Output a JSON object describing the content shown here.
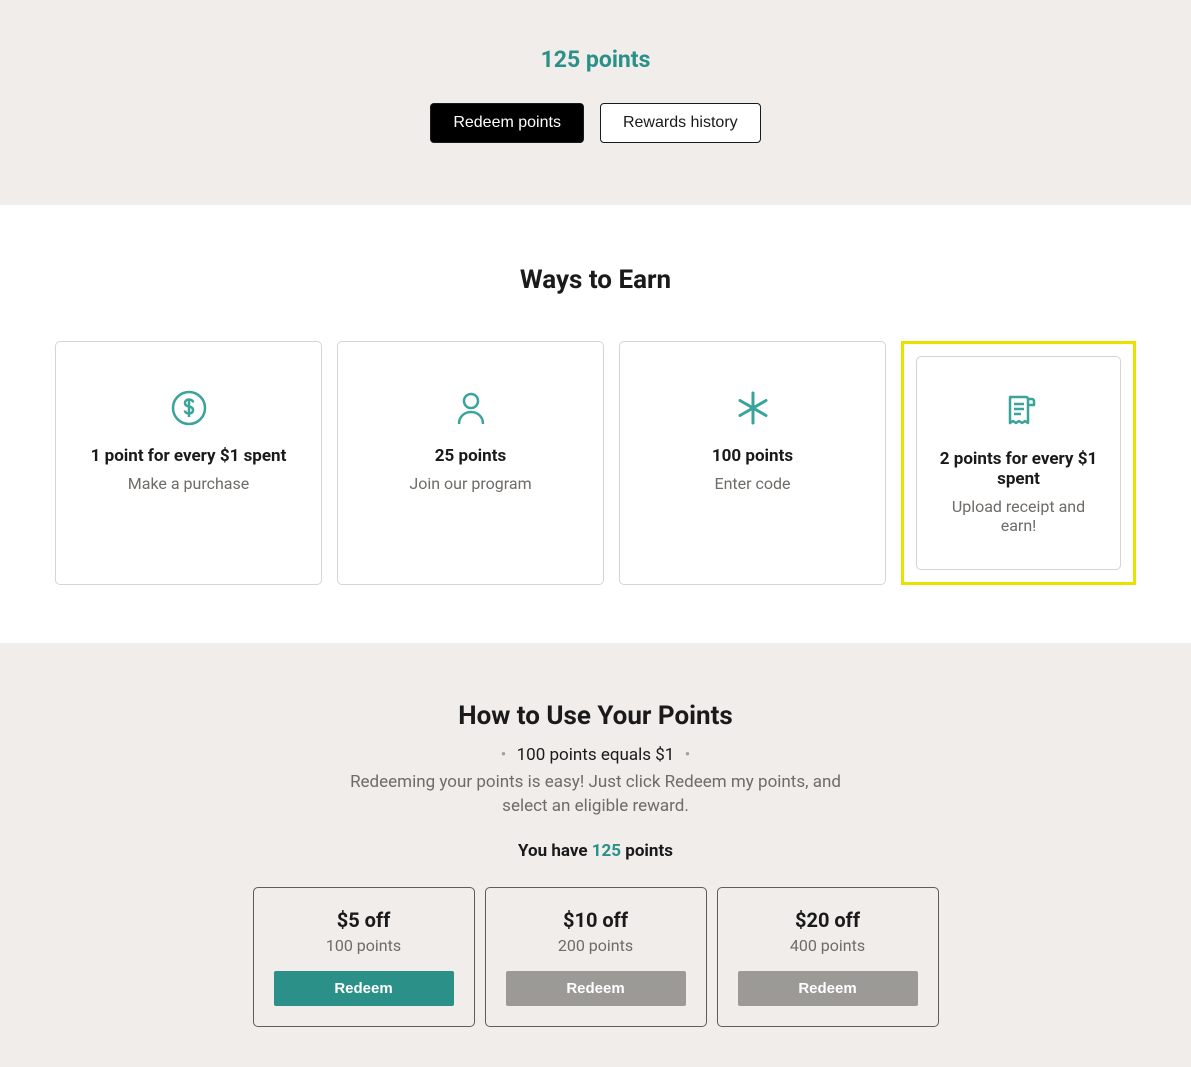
{
  "hero": {
    "points_label": "125 points",
    "redeem_button": "Redeem points",
    "history_button": "Rewards history"
  },
  "ways": {
    "heading": "Ways to Earn",
    "cards": [
      {
        "title": "1 point for every $1 spent",
        "subtitle": "Make a purchase"
      },
      {
        "title": "25 points",
        "subtitle": "Join our program"
      },
      {
        "title": "100 points",
        "subtitle": "Enter code"
      },
      {
        "title": "2 points for every $1 spent",
        "subtitle": "Upload receipt and earn!"
      }
    ]
  },
  "howto": {
    "heading": "How to Use Your Points",
    "conversion": "100 points equals $1",
    "description": "Redeeming your points is easy! Just click Redeem my points, and select an eligible reward.",
    "you_have_prefix": "You have ",
    "you_have_points": "125",
    "you_have_suffix": " points",
    "tiers": [
      {
        "title": "$5 off",
        "points": "100 points",
        "button": "Redeem",
        "enabled": true
      },
      {
        "title": "$10 off",
        "points": "200 points",
        "button": "Redeem",
        "enabled": false
      },
      {
        "title": "$20 off",
        "points": "400 points",
        "button": "Redeem",
        "enabled": false
      }
    ]
  }
}
